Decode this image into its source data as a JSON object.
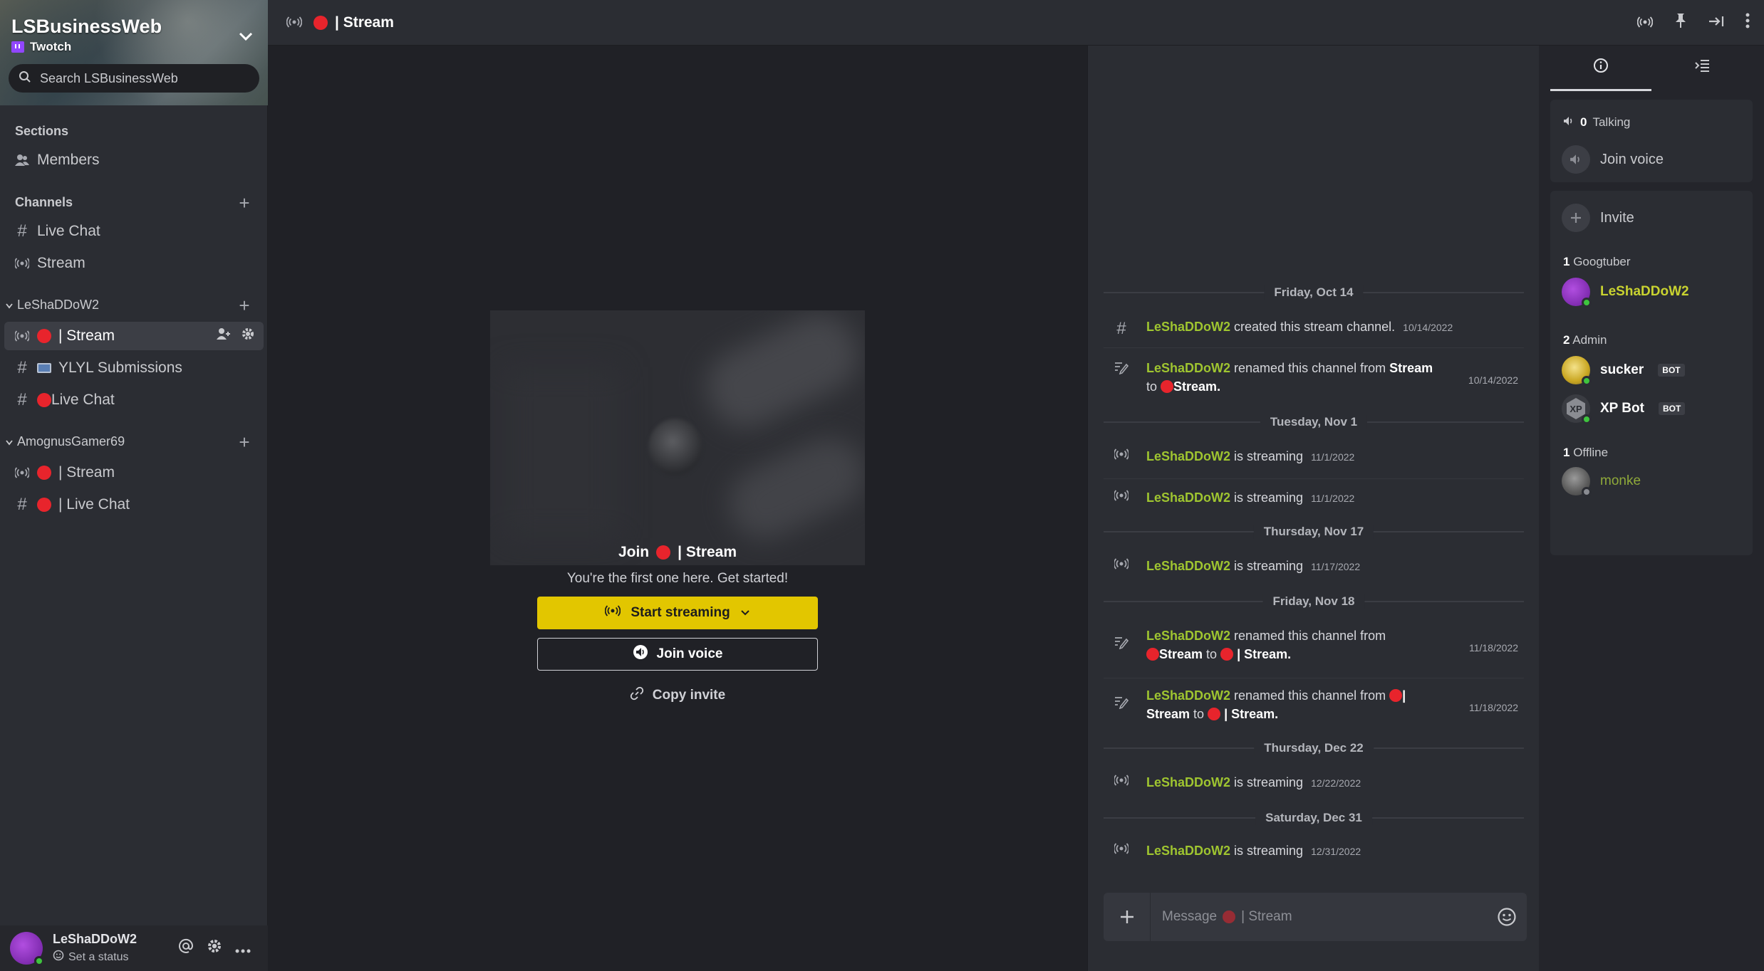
{
  "server": {
    "name": "LSBusinessWeb",
    "platform": "Twotch",
    "search_placeholder": "Search LSBusinessWeb"
  },
  "sidebar": {
    "sections_label": "Sections",
    "members_label": "Members",
    "channels_label": "Channels",
    "channels": [
      {
        "icon": "hash",
        "label": "Live Chat"
      },
      {
        "icon": "broadcast",
        "label": "Stream"
      }
    ],
    "groups": [
      {
        "name": "LeShaDDoW2",
        "items": [
          {
            "icon": "broadcast",
            "prefix": "red-dot",
            "label": "| Stream",
            "active": true
          },
          {
            "icon": "hash",
            "prefix": "tv",
            "label": "YLYL Submissions"
          },
          {
            "icon": "hash",
            "prefix": "red-dot",
            "label": "Live Chat"
          }
        ]
      },
      {
        "name": "AmognusGamer69",
        "items": [
          {
            "icon": "broadcast",
            "prefix": "red-dot",
            "label": "| Stream"
          },
          {
            "icon": "hash",
            "prefix": "red-dot",
            "label": "| Live Chat"
          }
        ]
      }
    ]
  },
  "user": {
    "name": "LeShaDDoW2",
    "status_prompt": "Set a status"
  },
  "topbar": {
    "channel_title": "| Stream"
  },
  "stage": {
    "join_prefix": "Join",
    "join_channel": "| Stream",
    "subtitle": "You're the first one here. Get started!",
    "start_streaming_label": "Start streaming",
    "join_voice_label": "Join voice",
    "copy_invite_label": "Copy invite"
  },
  "chat": {
    "dates": [
      "Friday, Oct 14",
      "Tuesday, Nov 1",
      "Thursday, Nov 17",
      "Friday, Nov 18",
      "Thursday, Dec 22",
      "Saturday, Dec 31"
    ],
    "author": "LeShaDDoW2",
    "messages": [
      {
        "text": "created this stream channel.",
        "time": "10/14/2022"
      },
      {
        "pre": "renamed this channel from",
        "from": "Stream",
        "to_word": "to",
        "to": "Stream.",
        "time": "10/14/2022"
      },
      {
        "text": "is streaming",
        "time": "11/1/2022"
      },
      {
        "text": "is streaming",
        "time": "11/1/2022"
      },
      {
        "text": "is streaming",
        "time": "11/17/2022"
      },
      {
        "pre": "renamed this channel from",
        "from": "Stream",
        "to_word": "to",
        "to": "| Stream.",
        "time": "11/18/2022"
      },
      {
        "pre": "renamed this channel from",
        "from1": "|",
        "from2": "Stream",
        "to_word": "to",
        "to": "| Stream.",
        "time": "11/18/2022"
      },
      {
        "text": "is streaming",
        "time": "12/22/2022"
      },
      {
        "text": "is streaming",
        "time": "12/31/2022"
      }
    ],
    "composer_placeholder_prefix": "Message",
    "composer_placeholder_channel": "| Stream"
  },
  "members_panel": {
    "talking_count": "0",
    "talking_label": "Talking",
    "join_voice_label": "Join voice",
    "invite_label": "Invite",
    "roles": [
      {
        "count": "1",
        "name": "Googtuber",
        "members": [
          {
            "name": "LeShaDDoW2",
            "status": "online"
          }
        ]
      },
      {
        "count": "2",
        "name": "Admin",
        "members": [
          {
            "name": "sucker",
            "bot": "BOT",
            "status": "online"
          },
          {
            "name": "XP Bot",
            "bot": "BOT",
            "status": "online"
          }
        ]
      },
      {
        "count": "1",
        "name": "Offline",
        "members": [
          {
            "name": "monke",
            "status": "offline"
          }
        ]
      }
    ]
  },
  "colors": {
    "accent_yellow": "#e2c600",
    "username_green": "#9fc530",
    "live_red": "#e8242c",
    "online_green": "#3ec43e"
  }
}
